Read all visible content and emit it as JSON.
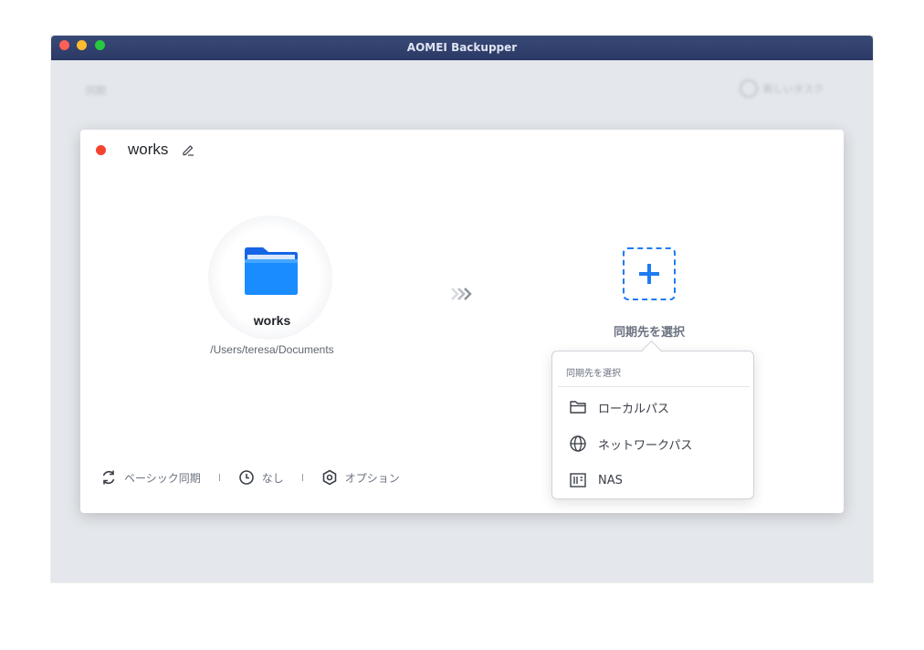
{
  "window": {
    "title": "AOMEI Backupper"
  },
  "background": {
    "left_label": "同期",
    "right_label": "新しいタスク"
  },
  "task": {
    "name": "works"
  },
  "source": {
    "name": "works",
    "path": "/Users/teresa/Documents",
    "icon": "folder-icon"
  },
  "destination": {
    "label": "同期先を選択",
    "icon": "plus-icon"
  },
  "bottom_bar": {
    "mode": "ベーシック同期",
    "schedule": "なし",
    "options": "オプション"
  },
  "dropdown": {
    "header": "同期先を選択",
    "items": [
      {
        "label": "ローカルパス",
        "icon": "folder-outline-icon"
      },
      {
        "label": "ネットワークパス",
        "icon": "globe-icon"
      },
      {
        "label": "NAS",
        "icon": "nas-icon"
      }
    ]
  },
  "colors": {
    "accent": "#1e7cf2",
    "status_red": "#f5422f",
    "titlebar": "#2f3d6b"
  }
}
